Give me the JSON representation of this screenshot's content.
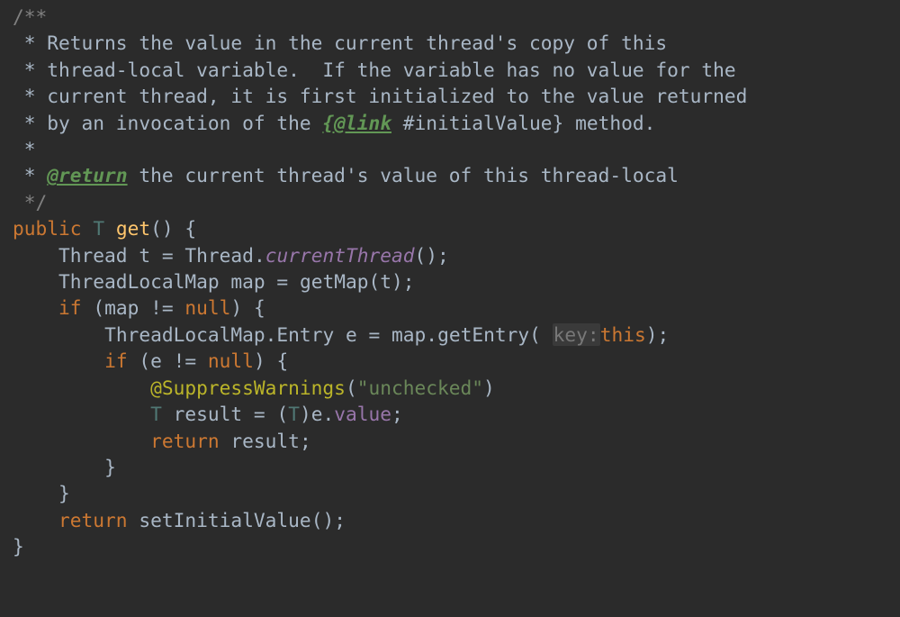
{
  "doc": {
    "open": "/**",
    "l1": " * Returns the value in the current thread's copy of this",
    "l2": " * thread-local variable.  If the variable has no value for the",
    "l3": " * current thread, it is first initialized to the value returned",
    "l4a": " * by an invocation of the ",
    "l4_tag": "{@link",
    "l4b": " #initialValue}",
    "l4c": " method.",
    "l5": " *",
    "l6a": " * ",
    "l6_tag": "@return",
    "l6b": " the current thread's value of this thread-local",
    "close": " */"
  },
  "kw": {
    "public": "public",
    "if": "if",
    "null": "null",
    "return": "return",
    "this": "this"
  },
  "ty": {
    "T": "T",
    "Thread": "Thread",
    "ThreadLocalMap": "ThreadLocalMap",
    "Entry": "Entry"
  },
  "m": {
    "get": "get",
    "currentThread": "currentThread",
    "getMap": "getMap",
    "getEntry": "getEntry",
    "setInitialValue": "setInitialValue"
  },
  "id": {
    "t": "t",
    "map": "map",
    "e": "e",
    "result": "result",
    "value": "value"
  },
  "ann": {
    "sw": "@SuppressWarnings"
  },
  "str": {
    "unchecked": "\"unchecked\""
  },
  "hint": {
    "key": "key:"
  },
  "p": {
    "sp": " ",
    "eq": " = ",
    "dot": ".",
    "op": "(",
    "cp": ")",
    "ob": "{",
    "cb": "}",
    "sc": ";",
    "ne": " != ",
    "ocast": "(",
    "ccast": ")",
    "emptyp": "()",
    "ind1": "    ",
    "ind2": "        ",
    "ind3": "            ",
    "ind4": "                "
  }
}
